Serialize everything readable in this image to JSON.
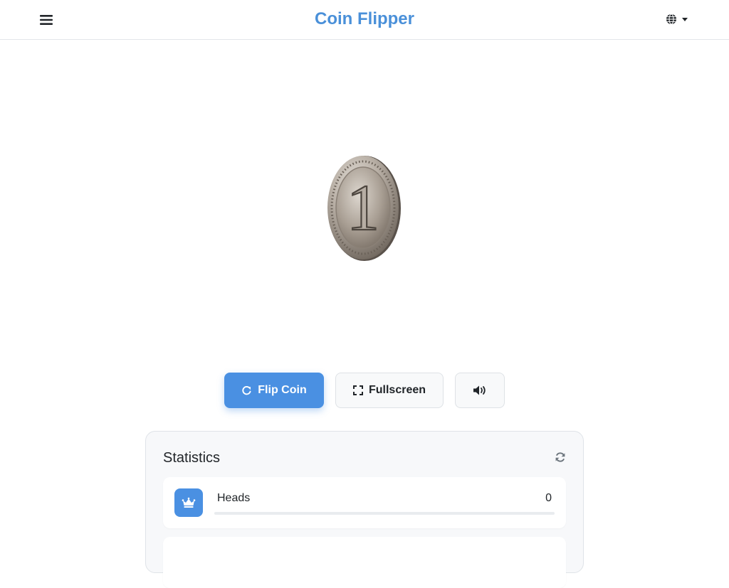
{
  "app": {
    "title": "Coin Flipper",
    "accent_color": "#4a90d9"
  },
  "header": {
    "menu_icon": "hamburger-menu-icon",
    "language_icon": "globe-icon"
  },
  "coin": {
    "face_text": "1",
    "icon": "coin-image"
  },
  "controls": {
    "flip_label": "Flip Coin",
    "flip_icon": "rotate-icon",
    "fullscreen_label": "Fullscreen",
    "fullscreen_icon": "expand-icon",
    "sound_icon": "volume-icon"
  },
  "statistics": {
    "title": "Statistics",
    "reset_icon": "refresh-icon",
    "items": [
      {
        "label": "Heads",
        "value": "0",
        "icon": "crown-icon",
        "fraction": 0
      }
    ]
  }
}
